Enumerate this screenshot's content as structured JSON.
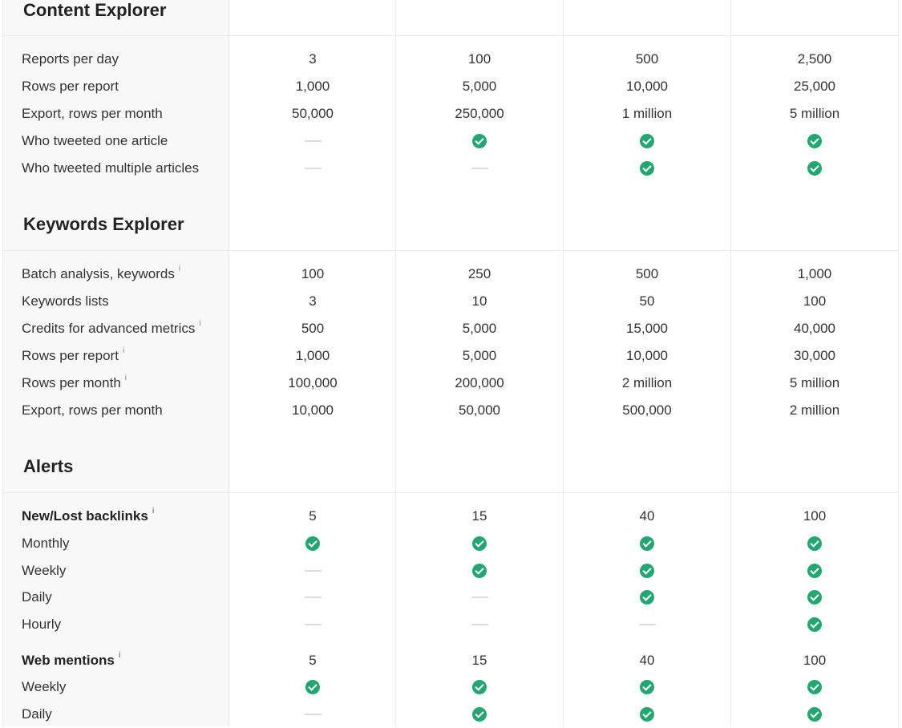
{
  "sections": {
    "content": {
      "title": "Content Explorer",
      "rows": [
        {
          "label": "Reports per day",
          "info": false,
          "bold": false,
          "cells": [
            "3",
            "100",
            "500",
            "2,500"
          ]
        },
        {
          "label": "Rows per report",
          "info": false,
          "bold": false,
          "cells": [
            "1,000",
            "5,000",
            "10,000",
            "25,000"
          ]
        },
        {
          "label": "Export, rows per month",
          "info": false,
          "bold": false,
          "cells": [
            "50,000",
            "250,000",
            "1 million",
            "5 million"
          ]
        },
        {
          "label": "Who tweeted one article",
          "info": false,
          "bold": false,
          "cells": [
            "dash",
            "check",
            "check",
            "check"
          ]
        },
        {
          "label": "Who tweeted multiple articles",
          "info": false,
          "bold": false,
          "cells": [
            "dash",
            "dash",
            "check",
            "check"
          ]
        }
      ]
    },
    "keywords": {
      "title": "Keywords Explorer",
      "rows": [
        {
          "label": "Batch analysis, keywords",
          "info": true,
          "bold": false,
          "cells": [
            "100",
            "250",
            "500",
            "1,000"
          ]
        },
        {
          "label": "Keywords lists",
          "info": false,
          "bold": false,
          "cells": [
            "3",
            "10",
            "50",
            "100"
          ]
        },
        {
          "label": "Credits for advanced metrics",
          "info": true,
          "bold": false,
          "cells": [
            "500",
            "5,000",
            "15,000",
            "40,000"
          ]
        },
        {
          "label": "Rows per report",
          "info": true,
          "bold": false,
          "cells": [
            "1,000",
            "5,000",
            "10,000",
            "30,000"
          ]
        },
        {
          "label": "Rows per month",
          "info": true,
          "bold": false,
          "cells": [
            "100,000",
            "200,000",
            "2 million",
            "5 million"
          ]
        },
        {
          "label": "Export, rows per month",
          "info": false,
          "bold": false,
          "cells": [
            "10,000",
            "50,000",
            "500,000",
            "2 million"
          ]
        }
      ]
    },
    "alerts": {
      "title": "Alerts",
      "rows": [
        {
          "label": "New/Lost backlinks",
          "info": true,
          "bold": true,
          "cells": [
            "5",
            "15",
            "40",
            "100"
          ]
        },
        {
          "label": "Monthly",
          "info": false,
          "bold": false,
          "cells": [
            "check",
            "check",
            "check",
            "check"
          ]
        },
        {
          "label": "Weekly",
          "info": false,
          "bold": false,
          "cells": [
            "dash",
            "check",
            "check",
            "check"
          ]
        },
        {
          "label": "Daily",
          "info": false,
          "bold": false,
          "cells": [
            "dash",
            "dash",
            "check",
            "check"
          ]
        },
        {
          "label": "Hourly",
          "info": false,
          "bold": false,
          "cells": [
            "dash",
            "dash",
            "dash",
            "check"
          ]
        },
        {
          "label": "Web mentions",
          "info": true,
          "bold": true,
          "cells": [
            "5",
            "15",
            "40",
            "100"
          ]
        },
        {
          "label": "Weekly",
          "info": false,
          "bold": false,
          "cells": [
            "check",
            "check",
            "check",
            "check"
          ]
        },
        {
          "label": "Daily",
          "info": false,
          "bold": false,
          "cells": [
            "dash",
            "check",
            "check",
            "check"
          ]
        }
      ]
    }
  },
  "info_glyph": "i",
  "colors": {
    "check": "#23a66f",
    "dash": "#dcdcdc",
    "label_bg": "#f8f8f8",
    "border": "#e9e9e9"
  }
}
